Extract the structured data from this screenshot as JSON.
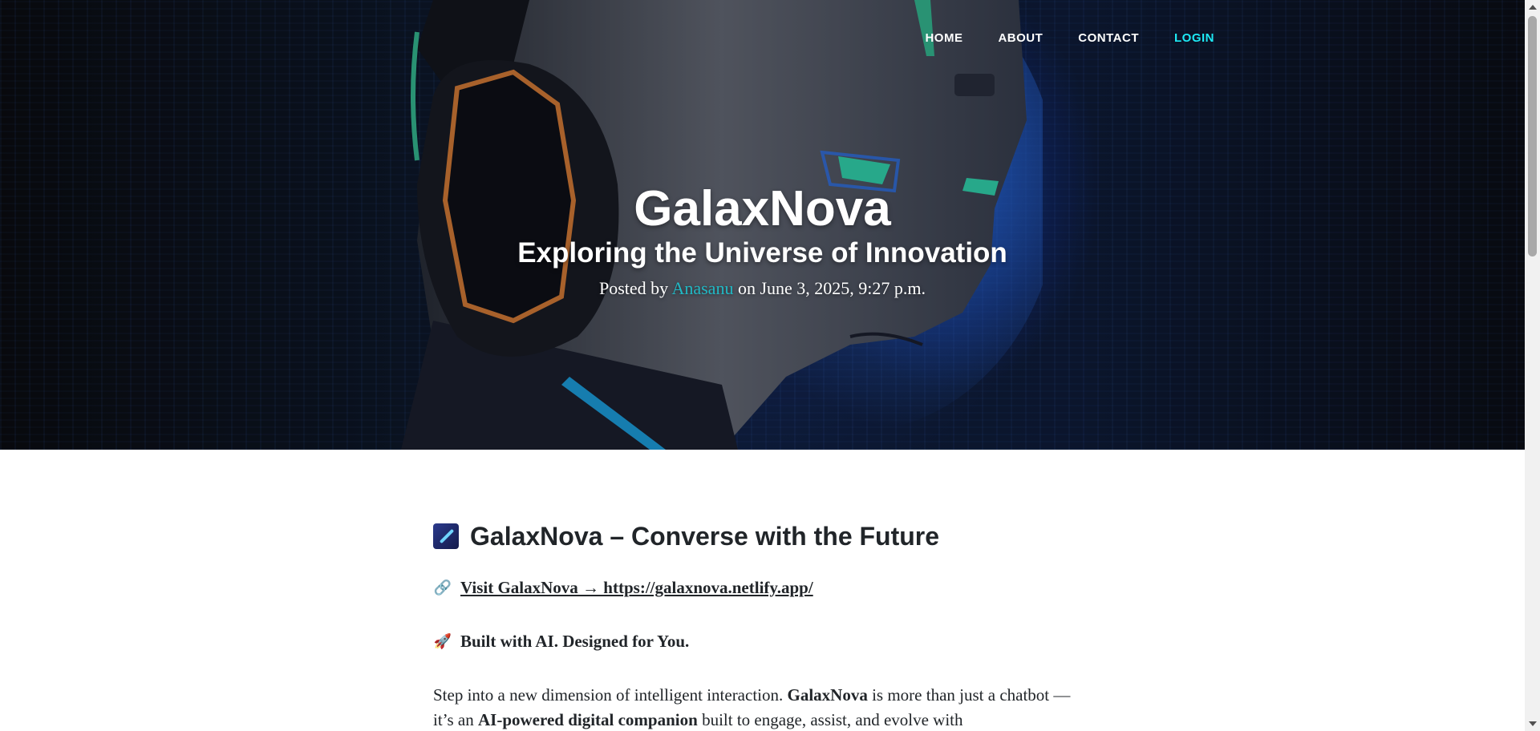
{
  "nav": {
    "items": [
      {
        "label": "HOME"
      },
      {
        "label": "ABOUT"
      },
      {
        "label": "CONTACT"
      },
      {
        "label": "LOGIN"
      }
    ],
    "active_color": "#1de9f5"
  },
  "hero": {
    "title": "GalaxNova",
    "subtitle": "Exploring the Universe of Innovation",
    "meta_prefix": "Posted by",
    "author": "Anasanu",
    "meta_date": "on June 3, 2025, 9:27 p.m."
  },
  "article": {
    "heading": "GalaxNova – Converse with the Future",
    "heading_icon": "comet-icon",
    "link_icon": "🔗",
    "link_text": "Visit GalaxNova → https://galaxnova.netlify.app/",
    "tagline_icon": "🚀",
    "tagline": "Built with AI. Designed for You.",
    "body": {
      "t1": "Step into a new dimension of intelligent interaction. ",
      "b1": "GalaxNova",
      "t2": " is more than just a chatbot — it’s an ",
      "b2": "AI-powered digital companion",
      "t3": " built to engage, assist, and evolve with"
    }
  },
  "colors": {
    "link_accent": "#21b8c4",
    "text": "#212529"
  }
}
